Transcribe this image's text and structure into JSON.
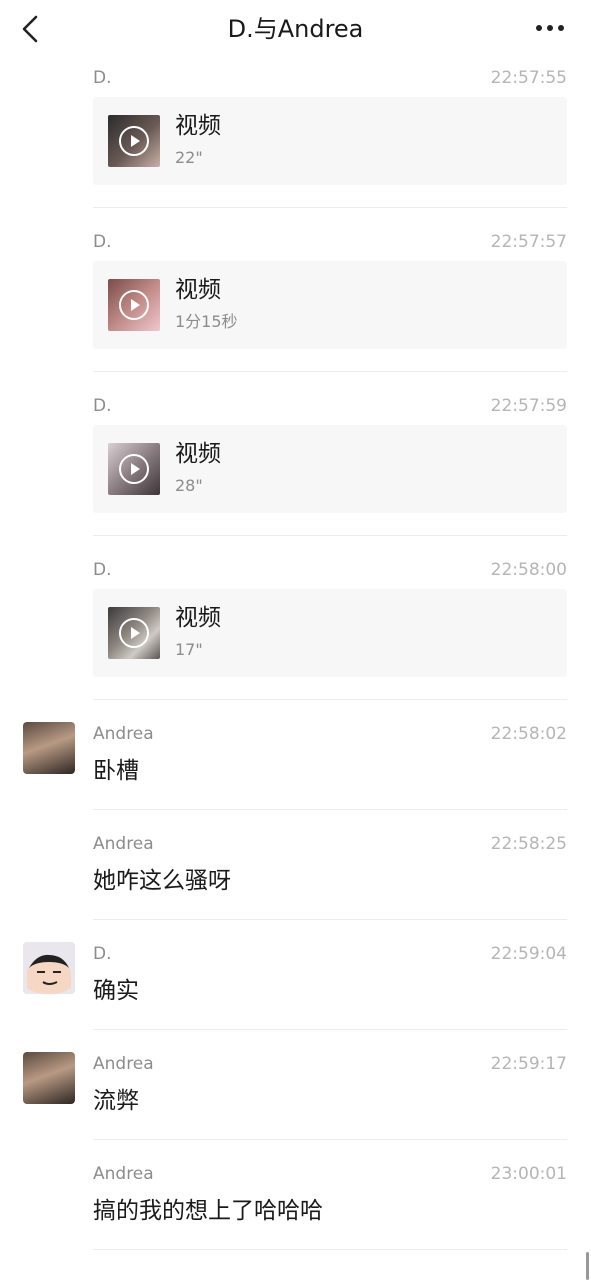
{
  "header": {
    "title": "D.与Andrea",
    "back_icon": "chevron-left-icon",
    "more_icon": "ellipsis-icon"
  },
  "messages": [
    {
      "sender": "D.",
      "time": "22:57:55",
      "type": "video",
      "card_title": "视频",
      "duration": "22\""
    },
    {
      "sender": "D.",
      "time": "22:57:57",
      "type": "video",
      "card_title": "视频",
      "duration": "1分15秒"
    },
    {
      "sender": "D.",
      "time": "22:57:59",
      "type": "video",
      "card_title": "视频",
      "duration": "28\""
    },
    {
      "sender": "D.",
      "time": "22:58:00",
      "type": "video",
      "card_title": "视频",
      "duration": "17\""
    },
    {
      "sender": "Andrea",
      "time": "22:58:02",
      "type": "text",
      "text": "卧槽"
    },
    {
      "sender": "Andrea",
      "time": "22:58:25",
      "type": "text",
      "text": "她咋这么骚呀"
    },
    {
      "sender": "D.",
      "time": "22:59:04",
      "type": "text",
      "text": "确实"
    },
    {
      "sender": "Andrea",
      "time": "22:59:17",
      "type": "text",
      "text": "流弊"
    },
    {
      "sender": "Andrea",
      "time": "23:00:01",
      "type": "text",
      "text": "搞的我的想上了哈哈哈"
    }
  ],
  "colors": {
    "background": "#ffffff",
    "card": "#f7f7f7",
    "sender": "#8c8c8c",
    "time": "#b5b5b5",
    "text": "#1a1a1a"
  }
}
